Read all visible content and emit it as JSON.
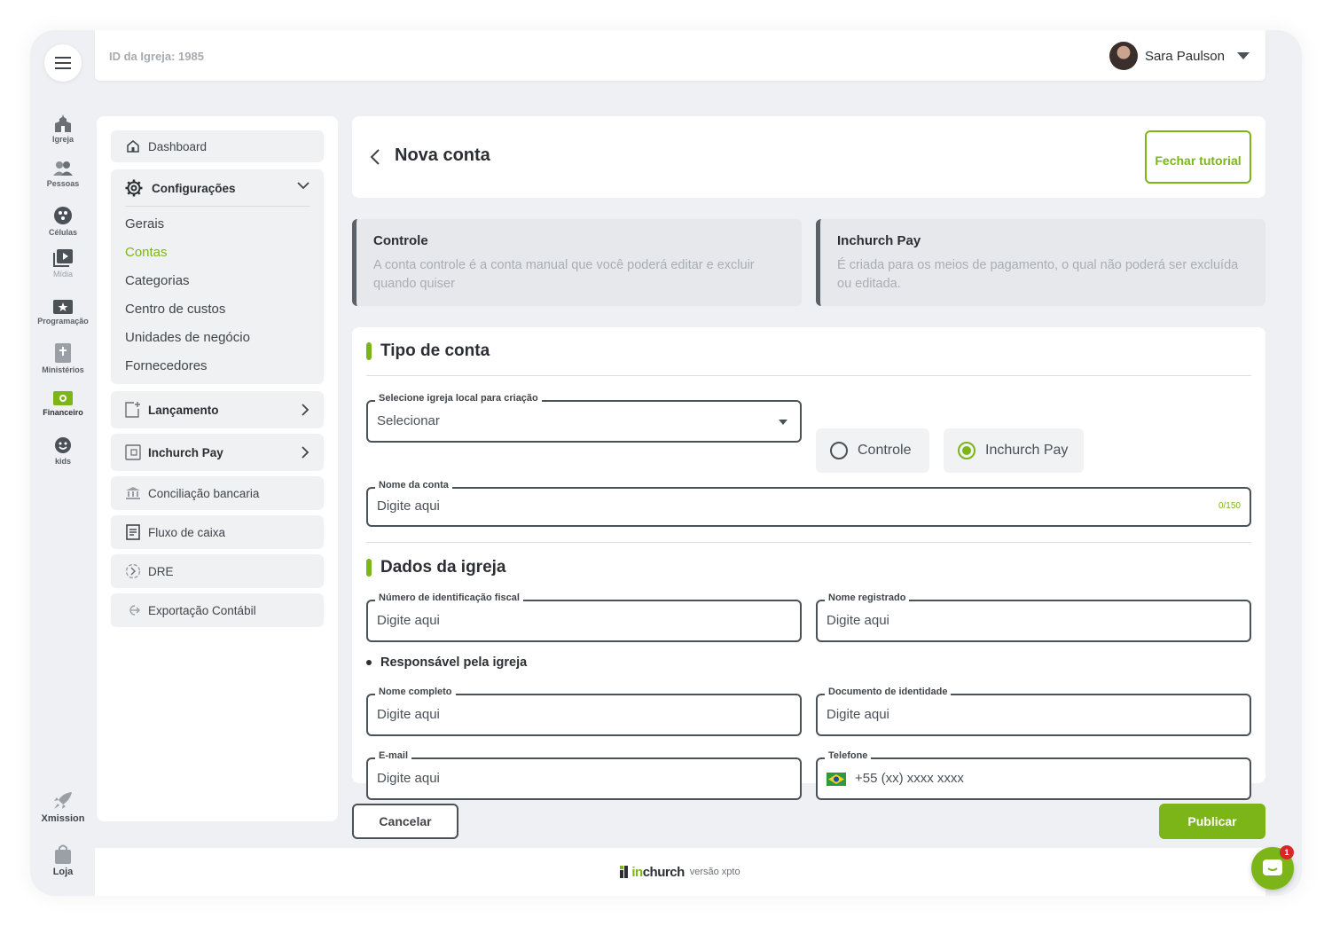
{
  "topbar": {
    "church_id": "ID da Igreja: 1985",
    "user_name": "Sara Paulson"
  },
  "rail": {
    "items": [
      {
        "label": "Igreja",
        "icon": "church-icon"
      },
      {
        "label": "Pessoas",
        "icon": "people-icon"
      },
      {
        "label": "Células",
        "icon": "cells-icon"
      },
      {
        "label": "Mídia",
        "icon": "media-icon"
      },
      {
        "label": "Programação",
        "icon": "calendar-icon"
      },
      {
        "label": "Ministérios",
        "icon": "bible-icon"
      },
      {
        "label": "Financeiro",
        "icon": "money-icon",
        "active": true
      },
      {
        "label": "kids",
        "icon": "kids-icon"
      }
    ],
    "xmission": "Xmission",
    "loja": "Loja"
  },
  "sidebar": {
    "dashboard": "Dashboard",
    "config": {
      "title": "Configurações",
      "items": [
        "Gerais",
        "Contas",
        "Categorias",
        "Centro de custos",
        "Unidades de negócio",
        "Fornecedores"
      ],
      "active": "Contas"
    },
    "lancamento": "Lançamento",
    "inchurch_pay": "Inchurch Pay",
    "conciliacao": "Conciliação bancaria",
    "fluxo": "Fluxo de caixa",
    "dre": "DRE",
    "exportacao": "Exportação Contábil"
  },
  "header": {
    "title": "Nova conta",
    "close_tutorial": "Fechar tutorial"
  },
  "info_cards": [
    {
      "title": "Controle",
      "text": "A conta controle é a conta manual que você poderá editar e excluir quando quiser"
    },
    {
      "title": "Inchurch Pay",
      "text": "É  criada para os meios de pagamento, o qual não poderá ser excluída ou editada."
    }
  ],
  "form": {
    "tipo_title": "Tipo de conta",
    "select_label": "Selecione igreja local para criação",
    "select_value": "Selecionar",
    "radio_controle": "Controle",
    "radio_inchurch": "Inchurch Pay",
    "radio_selected": "Inchurch Pay",
    "nome_conta_label": "Nome da conta",
    "placeholder": "Digite aqui",
    "nome_conta_count": "0/150",
    "dados_title": "Dados da igreja",
    "fiscal_label": "Número de identificação fiscal",
    "registrado_label": "Nome registrado",
    "responsavel_title": "Responsável pela igreja",
    "nome_completo_label": "Nome completo",
    "documento_label": "Documento de identidade",
    "email_label": "E-mail",
    "telefone_label": "Telefone",
    "telefone_placeholder": "+55 (xx) xxxx xxxx"
  },
  "actions": {
    "cancel": "Cancelar",
    "publish": "Publicar"
  },
  "footer": {
    "logo_prefix": "in",
    "logo_suffix": "church",
    "version": "versão xpto"
  },
  "chat": {
    "badge": "1"
  },
  "colors": {
    "accent": "#7cb518",
    "badge": "#d62828",
    "dark": "#4a5157"
  }
}
